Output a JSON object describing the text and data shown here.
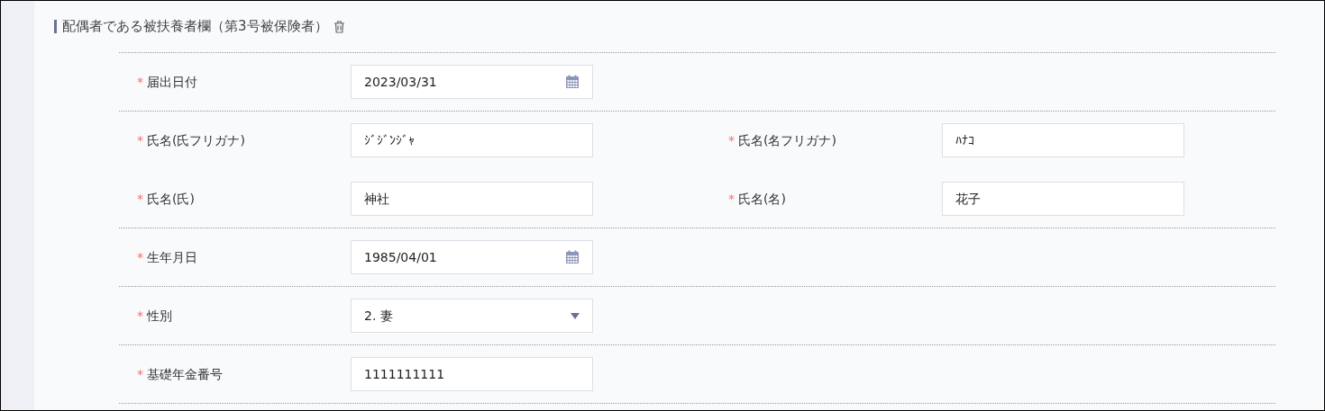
{
  "section": {
    "title": "配偶者である被扶養者欄（第3号被保険者）"
  },
  "groups": [
    {
      "rows": [
        [
          {
            "required_mark": "*",
            "label": "届出日付",
            "kind": "date",
            "value": "2023/03/31"
          }
        ]
      ]
    },
    {
      "rows": [
        [
          {
            "required_mark": "*",
            "label": "氏名(氏フリガナ)",
            "kind": "text",
            "value": "ｼﾞｼﾞﾝｼﾞｬ"
          },
          {
            "required_mark": "*",
            "label": "氏名(名フリガナ)",
            "kind": "text",
            "value": "ﾊﾅｺ"
          }
        ],
        [
          {
            "required_mark": "*",
            "label": "氏名(氏)",
            "kind": "text",
            "value": "神社"
          },
          {
            "required_mark": "*",
            "label": "氏名(名)",
            "kind": "text",
            "value": "花子"
          }
        ]
      ]
    },
    {
      "rows": [
        [
          {
            "required_mark": "*",
            "label": "生年月日",
            "kind": "date",
            "value": "1985/04/01"
          }
        ]
      ]
    },
    {
      "rows": [
        [
          {
            "required_mark": "*",
            "label": "性別",
            "kind": "select",
            "value": "2. 妻"
          }
        ]
      ]
    },
    {
      "rows": [
        [
          {
            "required_mark": "*",
            "label": "基礎年金番号",
            "kind": "text",
            "value": "1111111111"
          }
        ]
      ]
    }
  ]
}
